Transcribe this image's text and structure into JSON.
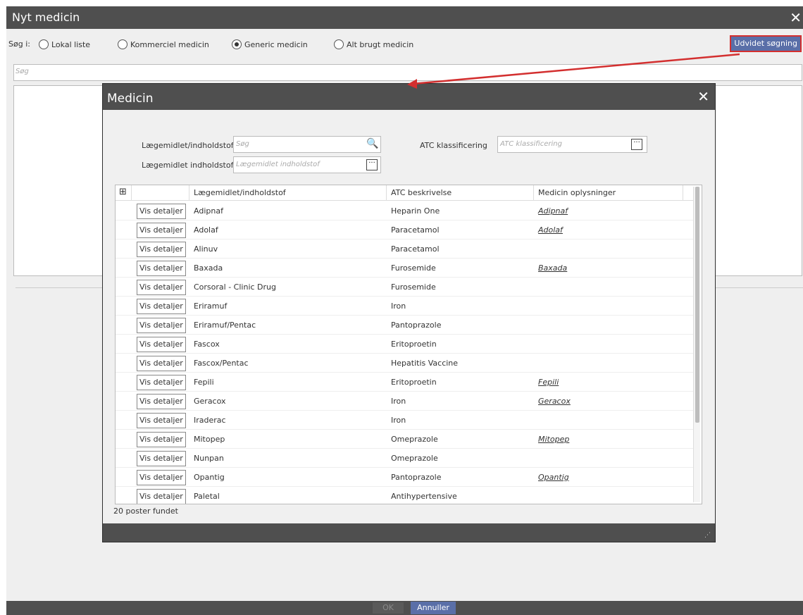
{
  "outer": {
    "title": "Nyt medicin",
    "search_in_label": "Søg i:",
    "radios": [
      {
        "label": "Lokal liste",
        "checked": false
      },
      {
        "label": "Kommerciel medicin",
        "checked": false
      },
      {
        "label": "Generic medicin",
        "checked": true
      },
      {
        "label": "Alt brugt medicin",
        "checked": false
      }
    ],
    "extended_search_button": "Udvidet søgning",
    "search_placeholder": "Søg",
    "ok_button": "OK",
    "cancel_button": "Annuller"
  },
  "dialog": {
    "title": "Medicin",
    "filters": {
      "substance_label": "Lægemidlet/indholdstof",
      "substance_placeholder": "Søg",
      "atc_label": "ATC klassificering",
      "atc_placeholder": "ATC klassificering",
      "substance2_label": "Lægemidlet indholdstof",
      "substance2_placeholder": "Lægemidlet indholdstof"
    },
    "grid": {
      "columns": [
        "Lægemidlet/indholdstof",
        "ATC beskrivelse",
        "Medicin oplysninger"
      ],
      "detail_button_label": "Vis detaljer",
      "rows": [
        {
          "name": "Adipnaf",
          "atc": "Heparin One",
          "info": "Adipnaf"
        },
        {
          "name": "Adolaf",
          "atc": "Paracetamol",
          "info": "Adolaf"
        },
        {
          "name": "Alinuv",
          "atc": "Paracetamol",
          "info": ""
        },
        {
          "name": "Baxada",
          "atc": "Furosemide",
          "info": "Baxada"
        },
        {
          "name": "Corsoral - Clinic Drug",
          "atc": "Furosemide",
          "info": ""
        },
        {
          "name": "Eriramuf",
          "atc": "Iron",
          "info": ""
        },
        {
          "name": "Eriramuf/Pentac",
          "atc": "Pantoprazole",
          "info": ""
        },
        {
          "name": "Fascox",
          "atc": "Eritoproetin",
          "info": ""
        },
        {
          "name": "Fascox/Pentac",
          "atc": "Hepatitis Vaccine",
          "info": ""
        },
        {
          "name": "Fepili",
          "atc": "Eritoproetin",
          "info": "Fepili"
        },
        {
          "name": "Geracox",
          "atc": "Iron",
          "info": "Geracox"
        },
        {
          "name": "Iraderac",
          "atc": "Iron",
          "info": ""
        },
        {
          "name": "Mitopep",
          "atc": "Omeprazole",
          "info": "Mitopep"
        },
        {
          "name": "Nunpan",
          "atc": "Omeprazole",
          "info": ""
        },
        {
          "name": "Opantig",
          "atc": "Pantoprazole",
          "info": "Opantig"
        },
        {
          "name": "Paletal",
          "atc": "Antihypertensive",
          "info": ""
        }
      ]
    },
    "records_found": "20 poster fundet"
  },
  "colors": {
    "titlebar": "#4f4f4f",
    "primary_button": "#5a6fa8",
    "highlight_border": "#d32f2f"
  }
}
